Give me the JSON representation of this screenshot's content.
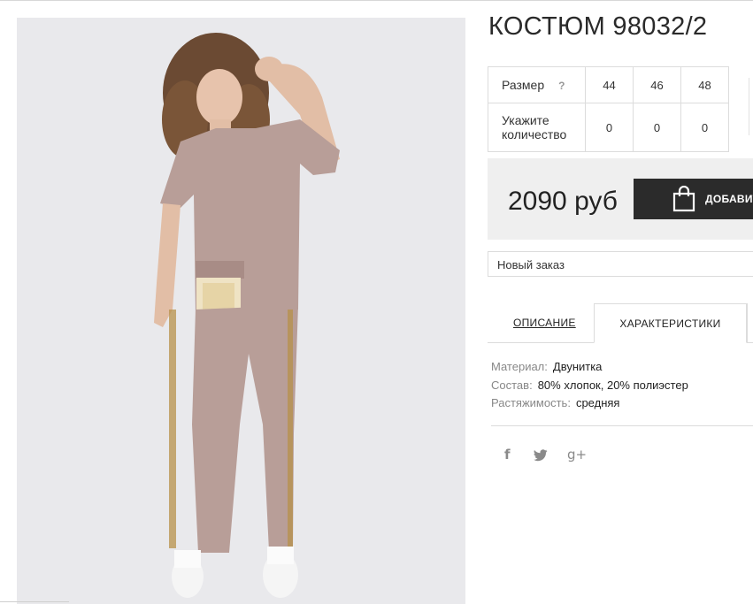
{
  "product": {
    "title": "КОСТЮМ 98032/2"
  },
  "size_table": {
    "size_label": "Размер",
    "size_help": "?",
    "sizes": [
      "44",
      "46",
      "48"
    ],
    "qty_label_1": "Укажите",
    "qty_label_2": "количество",
    "quantities": [
      "0",
      "0",
      "0"
    ]
  },
  "price": {
    "value": "2090 руб",
    "add_button": "ДОБАВИТЬ"
  },
  "order": {
    "selected": "Новый заказ"
  },
  "tabs": [
    {
      "label": "ОПИСАНИЕ"
    },
    {
      "label": "ХАРАКТЕРИСТИКИ"
    }
  ],
  "specs": [
    {
      "key": "Материал:",
      "value": "Двунитка"
    },
    {
      "key": "Состав:",
      "value": "80% хлопок, 20% полиэстер"
    },
    {
      "key": "Растяжимость:",
      "value": "средняя"
    }
  ],
  "social": {
    "facebook": "f",
    "twitter": "twitter-icon",
    "googleplus": "g+"
  },
  "colors": {
    "button_bg": "#2b2b2b",
    "price_box_bg": "#efefef",
    "suit_color": "#b89e98"
  }
}
